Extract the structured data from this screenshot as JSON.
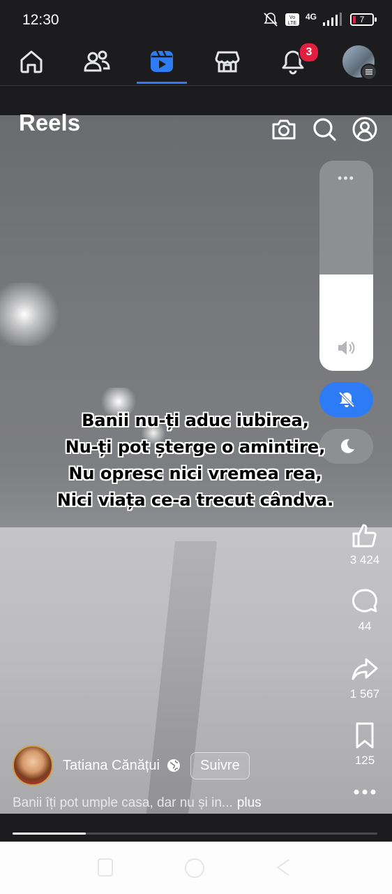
{
  "status_bar": {
    "time": "12:30",
    "network": "4G",
    "battery": "7"
  },
  "top_nav": {
    "items": [
      {
        "name": "home",
        "icon": "home-icon"
      },
      {
        "name": "friends",
        "icon": "friends-icon"
      },
      {
        "name": "reels",
        "icon": "reels-icon",
        "active": true
      },
      {
        "name": "marketplace",
        "icon": "marketplace-icon"
      },
      {
        "name": "notifications",
        "icon": "bell-icon",
        "badge": "3"
      },
      {
        "name": "profile",
        "icon": "profile-avatar"
      }
    ],
    "accent_color": "#2f7df6",
    "badge_color": "#e41e3f"
  },
  "reels_header": {
    "title": "Reels",
    "icons": [
      "camera-icon",
      "search-icon",
      "profile-icon"
    ]
  },
  "volume": {
    "level": 0.46,
    "icon": "speaker-icon"
  },
  "quick_toggles": {
    "mute_icon": "bell-off-icon",
    "dnd_icon": "moon-icon"
  },
  "caption_lines": [
    "Banii nu-ți aduc iubirea,",
    "Nu-ți pot șterge o amintire,",
    "Nu opresc nici vremea rea,",
    "Nici viața ce-a trecut cândva."
  ],
  "actions": {
    "likes": "3 424",
    "comments": "44",
    "shares": "1 567",
    "saves": "125"
  },
  "author": {
    "name": "Tatiana Cănățui",
    "follow_label": "Suivre"
  },
  "description": {
    "text": "Banii îți pot umple casa, dar nu și in...",
    "more_label": "plus"
  },
  "progress": 0.2
}
